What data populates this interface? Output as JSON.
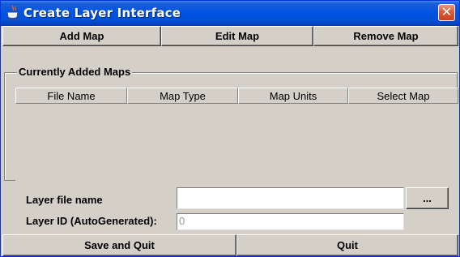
{
  "window": {
    "title": "Create Layer Interface",
    "close_glyph": "✕",
    "icon": "java-cup-icon"
  },
  "toolbar": {
    "add_label": "Add Map",
    "edit_label": "Edit Map",
    "remove_label": "Remove Map"
  },
  "maps_group": {
    "title": "Currently Added Maps",
    "columns": [
      "File Name",
      "Map Type",
      "Map Units",
      "Select Map"
    ],
    "rows": []
  },
  "form": {
    "layer_file_label": "Layer file name",
    "layer_file_value": "",
    "browse_label": "...",
    "layer_id_label": "Layer ID (AutoGenerated):",
    "layer_id_value": "0"
  },
  "footer": {
    "save_quit_label": "Save and Quit",
    "quit_label": "Quit"
  },
  "colors": {
    "titlebar": "#0054e3",
    "face": "#d4d0c8",
    "close": "#dc5b36"
  }
}
